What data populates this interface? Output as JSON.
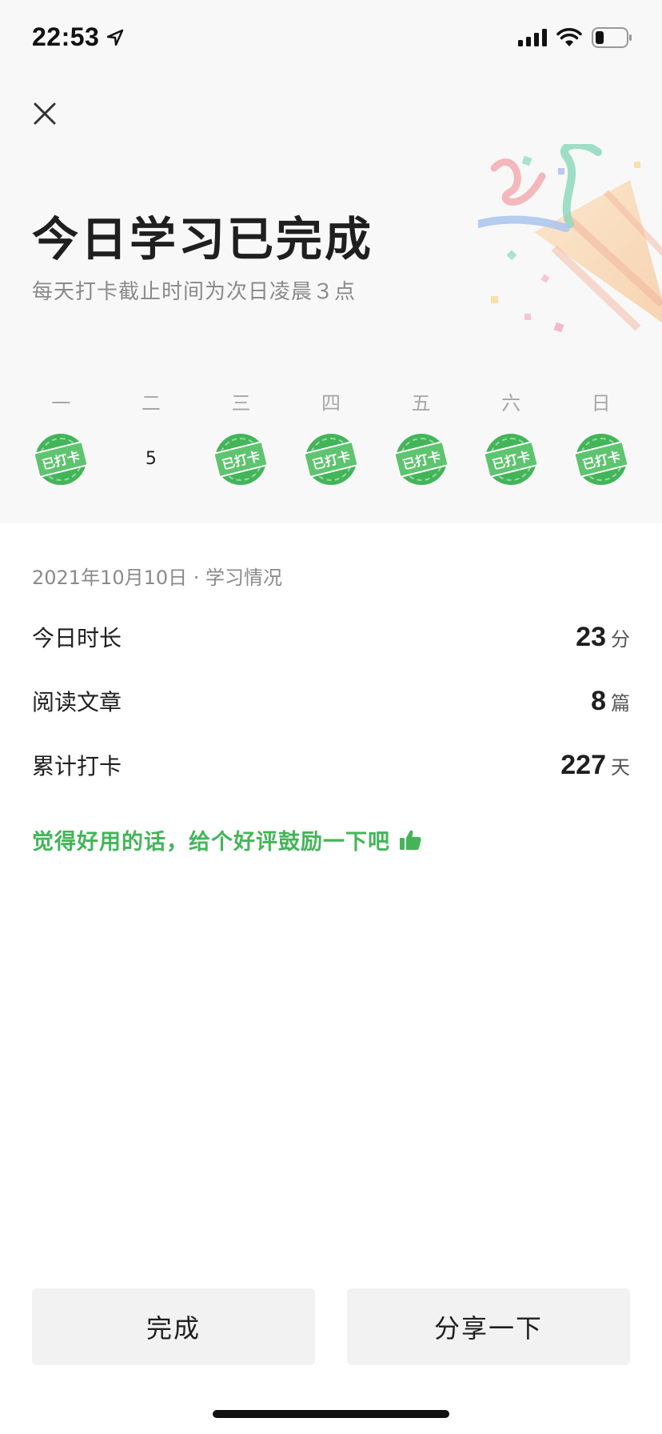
{
  "status_bar": {
    "time": "22:53"
  },
  "header": {
    "title": "今日学习已完成",
    "subtitle": "每天打卡截止时间为次日凌晨３点"
  },
  "week": [
    {
      "label": "一",
      "checked": true,
      "stamp": "已打卡"
    },
    {
      "label": "二",
      "checked": false,
      "value": "5"
    },
    {
      "label": "三",
      "checked": true,
      "stamp": "已打卡"
    },
    {
      "label": "四",
      "checked": true,
      "stamp": "已打卡"
    },
    {
      "label": "五",
      "checked": true,
      "stamp": "已打卡"
    },
    {
      "label": "六",
      "checked": true,
      "stamp": "已打卡"
    },
    {
      "label": "日",
      "checked": true,
      "stamp": "已打卡"
    }
  ],
  "stats": {
    "heading": "2021年10月10日 · 学习情况",
    "items": [
      {
        "label": "今日时长",
        "value": "23",
        "unit": "分"
      },
      {
        "label": "阅读文章",
        "value": "8",
        "unit": "篇"
      },
      {
        "label": "累计打卡",
        "value": "227",
        "unit": "天"
      }
    ]
  },
  "promo": {
    "text": "觉得好用的话，给个好评鼓励一下吧"
  },
  "buttons": {
    "done": "完成",
    "share": "分享一下"
  },
  "colors": {
    "accent": "#43b559",
    "top_bg": "#f8f8f8",
    "button_bg": "#f2f2f2"
  }
}
